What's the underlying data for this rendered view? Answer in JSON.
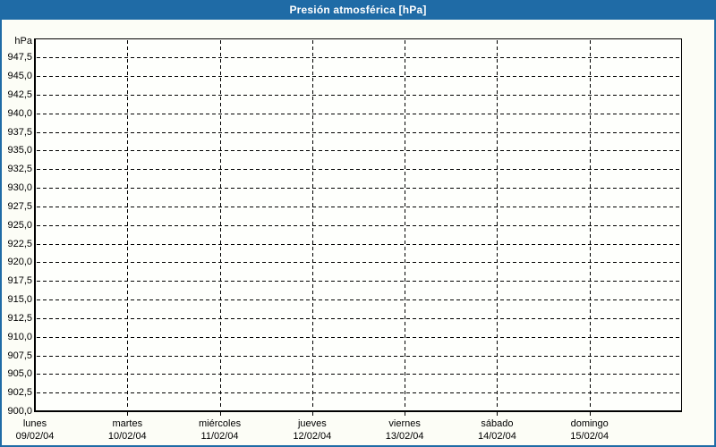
{
  "window": {
    "title": "Presión atmosférica [hPa]"
  },
  "colors": {
    "frame_blue": "#1F6BA6",
    "content_bg": "#FCFDF6",
    "plot_bg": "#FEFFFC",
    "grid_line": "#000000",
    "axis_line": "#000000",
    "label_text": "#000000",
    "title_text": "#FFFFFF"
  },
  "chart_data": {
    "type": "line",
    "title": "Presión atmosférica [hPa]",
    "xlabel": "",
    "ylabel": "hPa",
    "ylim": [
      900,
      950
    ],
    "ytick_step": 2.5,
    "grid": "dashed",
    "legend": "none",
    "decimal_separator": ",",
    "yticks": [
      {
        "value": 947.5,
        "label": "947,5"
      },
      {
        "value": 945.0,
        "label": "945,0"
      },
      {
        "value": 942.5,
        "label": "942,5"
      },
      {
        "value": 940.0,
        "label": "940,0"
      },
      {
        "value": 937.5,
        "label": "937,5"
      },
      {
        "value": 935.0,
        "label": "935,0"
      },
      {
        "value": 932.5,
        "label": "932,5"
      },
      {
        "value": 930.0,
        "label": "930,0"
      },
      {
        "value": 927.5,
        "label": "927,5"
      },
      {
        "value": 925.0,
        "label": "925,0"
      },
      {
        "value": 922.5,
        "label": "922,5"
      },
      {
        "value": 920.0,
        "label": "920,0"
      },
      {
        "value": 917.5,
        "label": "917,5"
      },
      {
        "value": 915.0,
        "label": "915,0"
      },
      {
        "value": 912.5,
        "label": "912,5"
      },
      {
        "value": 910.0,
        "label": "910,0"
      },
      {
        "value": 907.5,
        "label": "907,5"
      },
      {
        "value": 905.0,
        "label": "905,0"
      },
      {
        "value": 902.5,
        "label": "902,5"
      },
      {
        "value": 900.0,
        "label": "900,0"
      }
    ],
    "x_categories": [
      {
        "day": "lunes",
        "date": "09/02/04"
      },
      {
        "day": "martes",
        "date": "10/02/04"
      },
      {
        "day": "miércoles",
        "date": "11/02/04"
      },
      {
        "day": "jueves",
        "date": "12/02/04"
      },
      {
        "day": "viernes",
        "date": "13/02/04"
      },
      {
        "day": "sábado",
        "date": "14/02/04"
      },
      {
        "day": "domingo",
        "date": "15/02/04"
      }
    ],
    "series": []
  }
}
